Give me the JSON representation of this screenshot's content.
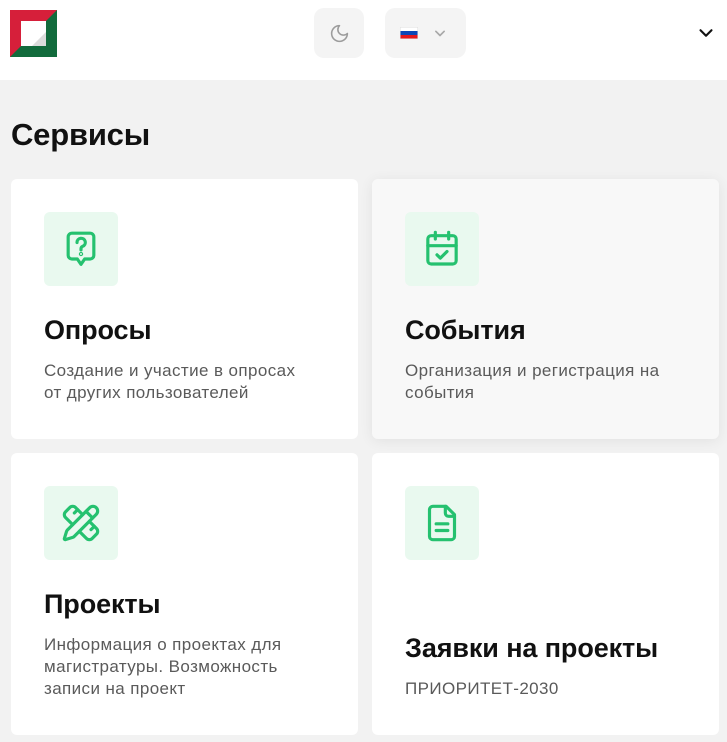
{
  "header": {
    "logo_icon": "logo",
    "theme_toggle_icon": "moon-icon",
    "language_flag_icon": "russia-flag-icon",
    "language_dropdown_icon": "chevron-down-icon",
    "menu_icon": "chevron-down-icon"
  },
  "page_title": "Сервисы",
  "services": [
    {
      "icon": "question-bubble-icon",
      "title": "Опросы",
      "description": "Создание и участие в опросах от других пользователей"
    },
    {
      "icon": "calendar-check-icon",
      "title": "События",
      "description": "Организация и регистрация на события"
    },
    {
      "icon": "pencil-ruler-icon",
      "title": "Проекты",
      "description": "Информация о проектах для магистратуры. Возможность записи на проект"
    },
    {
      "icon": "document-icon",
      "title": "Заявки на проекты",
      "description": "ПРИОРИТЕТ-2030"
    }
  ],
  "colors": {
    "accent": "#25c16f",
    "accent_bg": "#e9f9ef",
    "page_bg": "#f2f2f2",
    "logo_red": "#d61f3a",
    "logo_green": "#126b3c"
  }
}
